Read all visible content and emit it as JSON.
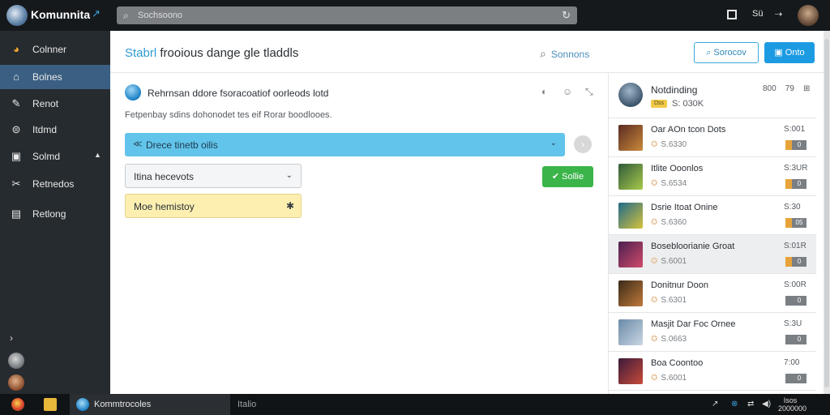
{
  "app": {
    "brand": "Komunnita",
    "brand_mark": "↗",
    "search_placeholder": "Sochsoono",
    "top_icons": [
      "window-icon",
      "user-icon",
      "overflow-icon"
    ],
    "top_labels": {
      "user": "Sü",
      "overflow": "⇢"
    }
  },
  "sidebar": {
    "items": [
      {
        "label": "Colnner",
        "icon": "globe-icon",
        "glyph": "◕"
      },
      {
        "label": "Bolnes",
        "icon": "home-icon",
        "glyph": "⌂",
        "active": true
      },
      {
        "label": "Renot",
        "icon": "wrench-icon",
        "glyph": "✎"
      },
      {
        "label": "Itdmd",
        "icon": "badge-icon",
        "glyph": "⊜"
      },
      {
        "label": "Solmd",
        "icon": "book-icon",
        "glyph": "▣",
        "chevron": "▲"
      },
      {
        "label": "Retnedos",
        "icon": "tools-icon",
        "glyph": "✂"
      },
      {
        "label": "Retlong",
        "icon": "list-icon",
        "glyph": "▤"
      }
    ],
    "bottom_arrow": "›"
  },
  "header": {
    "title_accent": "Stabrl",
    "title_rest": "frooious dange gle tladdls",
    "search_label": "Sonnons",
    "outline_button": "Sorocov",
    "blue_button": "Onto"
  },
  "content": {
    "post_title": "Rehrnsan ddore fsoracoatiof oorleods lotd",
    "post_actions": [
      "◐",
      "☺",
      "⤡"
    ],
    "post_subtitle": "Fetpenbay sdins dohonodet tes eif Rorar boodlooes.",
    "bar_label": "Drece tinetb oilis",
    "bar_icon": "≪",
    "bar_chevron": "⌄",
    "circle_button": "›",
    "select_value": "Itina hecevots",
    "select_chevron": "⌄",
    "green_button": "✔ Sollie",
    "note_value": "Moe hemistoy",
    "note_icon": "✱"
  },
  "rpanel": {
    "name": "Notdinding",
    "badge": "Dss",
    "score": "S: 030K",
    "actions": "800    79    ⊞",
    "rows": [
      {
        "title": "Oar AOn tcon Dots",
        "meta": "S.6330",
        "value": "S:001",
        "tag_color": "#e8a33a",
        "tag": "0",
        "thumb": [
          "#5a2a22",
          "#c98a3a"
        ]
      },
      {
        "title": "Itlite Ooonlos",
        "meta": "S.6534",
        "value": "S:3UR",
        "tag_color": "#e8a33a",
        "tag": "0",
        "thumb": [
          "#2f5a3a",
          "#a8c94a"
        ]
      },
      {
        "title": "Dsrie Itoat Onine",
        "meta": "S.6360",
        "value": "S:30",
        "tag_color": "#e8a33a",
        "tag": "05",
        "thumb": [
          "#1f6a8a",
          "#d6c23a"
        ]
      },
      {
        "title": "Bosebloorianie Groat",
        "meta": "S.6001",
        "value": "S:01R",
        "tag_color": "#e8a33a",
        "tag": "0",
        "thumb": [
          "#4a2050",
          "#d04a6a"
        ],
        "selected": true
      },
      {
        "title": "Donitnur Doon",
        "meta": "S.6301",
        "value": "S:00R",
        "tag_color": "#7a7f84",
        "tag": "0",
        "thumb": [
          "#3a2a1a",
          "#c07a3a"
        ]
      },
      {
        "title": "Masjit Dar Foc Ornee",
        "meta": "S.0663",
        "value": "S:3U",
        "tag_color": "#7a7f84",
        "tag": "0",
        "thumb": [
          "#6a8aa8",
          "#c9d6e2"
        ]
      },
      {
        "title": "Boa Coontoo",
        "meta": "S.6001",
        "value": "7:00",
        "tag_color": "#7a7f84",
        "tag": "0",
        "thumb": [
          "#3a1a3a",
          "#c84a3a"
        ]
      }
    ]
  },
  "taskbar": {
    "active_label": "Kommtrocoles",
    "extra_label": "Italio",
    "tray": [
      "↗",
      "⊗",
      "⇄",
      "◀)"
    ],
    "clock_line1": "Isos",
    "clock_line2": "2000000"
  }
}
